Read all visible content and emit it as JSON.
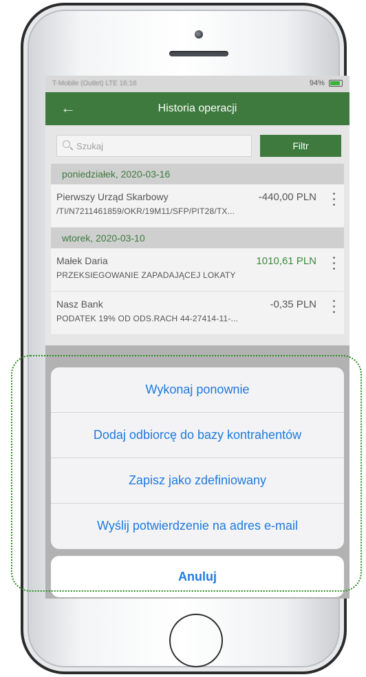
{
  "statusbar": {
    "carrier": "T-Mobile (Outlet) LTE 16:16",
    "battery_percent": "94%"
  },
  "header": {
    "title": "Historia operacji",
    "back_icon": "back-arrow-icon"
  },
  "search": {
    "placeholder": "Szukaj",
    "filter_label": "Filtr"
  },
  "groups": [
    {
      "date": "poniedziałek, 2020-03-16",
      "transactions": [
        {
          "name": "Pierwszy Urząd Skarbowy",
          "amount": "-440,00 PLN",
          "description": "/TI/N7211461859/OKR/19M11/SFP/PIT28/TX..."
        }
      ]
    },
    {
      "date": "wtorek, 2020-03-10",
      "transactions": [
        {
          "name": "Małek Daria",
          "amount": "1010,61 PLN",
          "description": "PRZEKSIEGOWANIE ZAPADAJĄCEJ LOKATY"
        },
        {
          "name": "Nasz Bank",
          "amount": "-0,35 PLN",
          "description": "PODATEK 19% OD ODS.RACH 44-27414-11-..."
        }
      ]
    }
  ],
  "action_sheet": {
    "options": [
      "Wykonaj ponownie",
      "Dodaj odbiorcę do bazy kontrahentów",
      "Zapisz jako zdefiniowany",
      "Wyślij potwierdzenie na adres e-mail"
    ],
    "cancel_label": "Anuluj"
  },
  "colors": {
    "brand_green": "#3e7a3e",
    "positive_amount": "#3e8a3e",
    "ios_blue": "#1f7ae0",
    "highlight": "#2a8a1e"
  }
}
